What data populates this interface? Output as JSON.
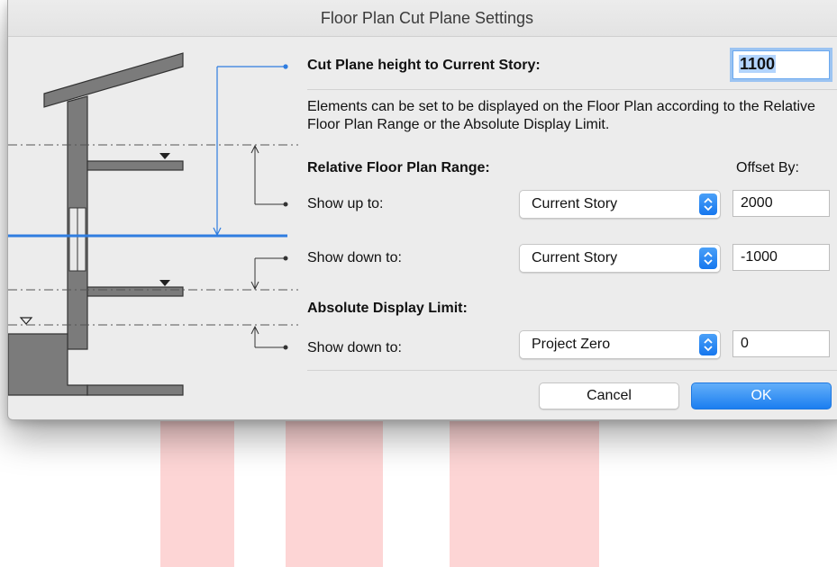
{
  "window": {
    "title": "Floor Plan Cut Plane Settings"
  },
  "cut_plane": {
    "label": "Cut Plane height to Current Story:",
    "value": "1100"
  },
  "description": "Elements can be set to be displayed on the Floor Plan according to the Relative Floor Plan Range or the Absolute Display Limit.",
  "relative": {
    "heading": "Relative Floor Plan Range:",
    "offset_header": "Offset By:",
    "show_up": {
      "label": "Show up to:",
      "selected": "Current Story",
      "offset": "2000"
    },
    "show_down": {
      "label": "Show down to:",
      "selected": "Current Story",
      "offset": "-1000"
    }
  },
  "absolute": {
    "heading": "Absolute Display Limit:",
    "show_down": {
      "label": "Show down to:",
      "selected": "Project Zero",
      "offset": "0"
    }
  },
  "buttons": {
    "cancel": "Cancel",
    "ok": "OK"
  },
  "colors": {
    "accent": "#1b7ef0",
    "cut_line": "#2f7de0",
    "structure": "#7b7b7b",
    "background_bar": "#fdd5d5"
  }
}
